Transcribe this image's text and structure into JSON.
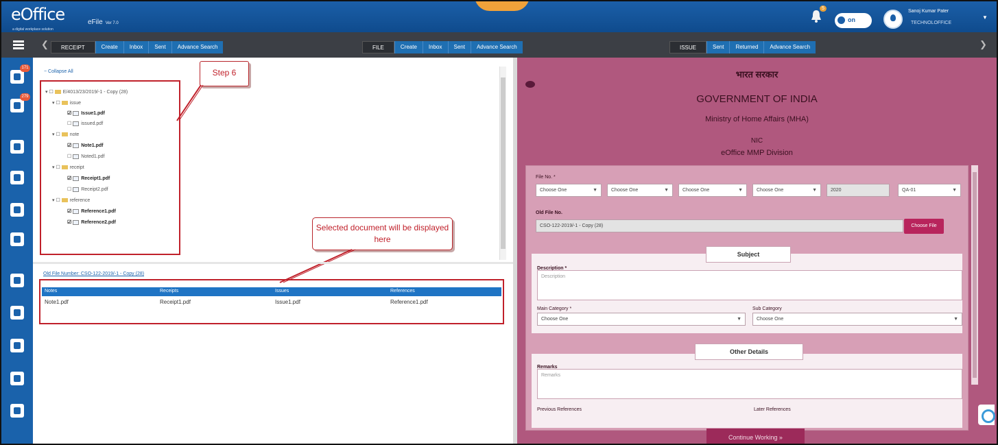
{
  "header": {
    "logo_text": "eOffice",
    "logo_tagline": "a digital workplace solution",
    "app_name": "eFile",
    "app_version": "Ver 7.0",
    "notification_count": "5",
    "toggle_label": "on",
    "user_name": "Sanoj Kumar Pater",
    "user_role": "TECHNOLOFFICE"
  },
  "nav": {
    "receipt_group": {
      "head": "RECEIPT",
      "links": [
        "Create",
        "Inbox",
        "Sent",
        "Advance Search"
      ]
    },
    "file_group": {
      "head": "FILE",
      "links": [
        "Create",
        "Inbox",
        "Sent",
        "Advance Search"
      ]
    },
    "issue_group": {
      "head": "ISSUE",
      "links": [
        "Sent",
        "Returned",
        "Advance Search"
      ]
    }
  },
  "sidebar": {
    "icons": [
      "receipt-icon",
      "file-icon",
      "dak-icon",
      "home-icon",
      "movement-icon",
      "transfer-icon",
      "mobile-icon",
      "record-icon",
      "archive-icon",
      "printer-icon",
      "settings-icon"
    ],
    "badges": [
      "171",
      "279"
    ]
  },
  "left_panel": {
    "collapse_all": "Collapse All",
    "tree": {
      "root": "E/4013/23/2019/-1 - Copy (28)",
      "issue_folder": "issue",
      "issue_files": [
        "Issue1.pdf",
        "issued.pdf"
      ],
      "note_folder": "note",
      "note_files": [
        "Note1.pdf",
        "Noted1.pdf"
      ],
      "receipt_folder": "receipt",
      "receipt_files": [
        "Receipt1.pdf",
        "Receipt2.pdf"
      ],
      "reference_folder": "reference",
      "reference_files": [
        "Reference1.pdf",
        "Reference2.pdf"
      ]
    },
    "step_callout": "Step 6",
    "selected_callout": "Selected document will be displayed here",
    "file_number_label": "Old File Number: CSO-122-2019/-1 - Copy (28)",
    "doc_table": {
      "headers": [
        "Notes",
        "Receipts",
        "Issues",
        "References"
      ],
      "row": [
        "Note1.pdf",
        "Receipt1.pdf",
        "Issue1.pdf",
        "Reference1.pdf"
      ]
    }
  },
  "right_panel": {
    "hindi_title": "भारत सरकार",
    "gov_title": "GOVERNMENT OF INDIA",
    "ministry": "Ministry of Home Affairs (MHA)",
    "dept": "NIC",
    "division": "eOffice MMP Division",
    "file_no_label": "File No. *",
    "file_no_fields": [
      "Choose One",
      "Choose One",
      "Choose One",
      "Choose One"
    ],
    "year_value": "2020",
    "computer_no": "QA-01",
    "old_file_label": "Old File No.",
    "old_file_value": "CSO-122-2019/-1 - Copy (28)",
    "choose_file_button": "Choose File",
    "subject_title": "Subject",
    "description_label": "Description *",
    "description_placeholder": "Description",
    "main_category_label": "Main Category *",
    "main_category_value": "Choose One",
    "sub_category_label": "Sub Category",
    "sub_category_value": "Choose One",
    "other_details_title": "Other Details",
    "remarks_label": "Remarks",
    "remarks_placeholder": "Remarks",
    "previous_references_label": "Previous References",
    "later_references_label": "Later References",
    "continue_button": "Continue Working »"
  }
}
